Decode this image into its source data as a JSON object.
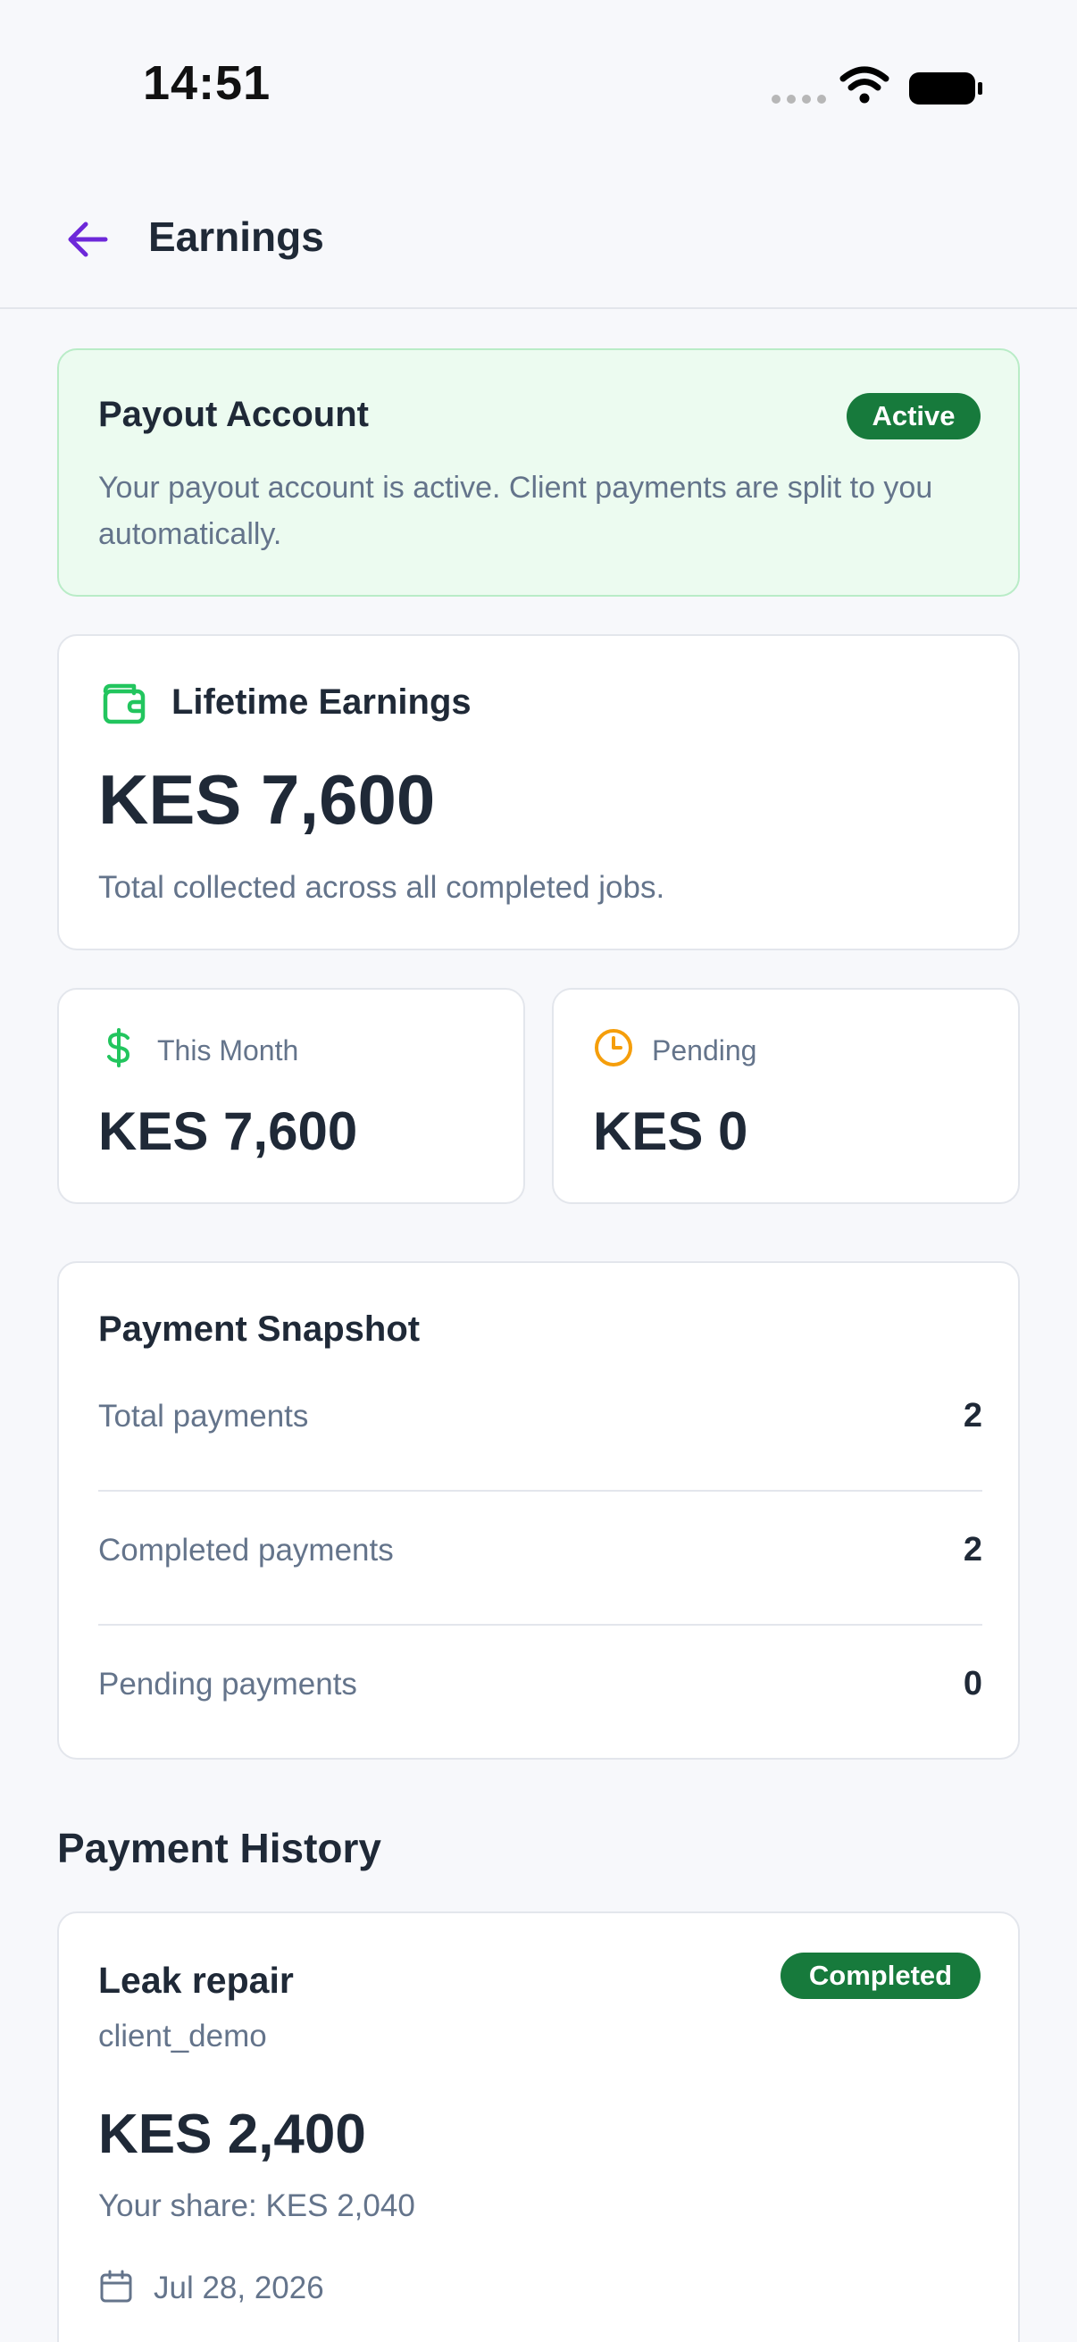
{
  "status_bar": {
    "time": "14:51"
  },
  "header": {
    "title": "Earnings",
    "back_icon": "arrow-left-icon",
    "accent_color": "#6d28d9"
  },
  "payout_account": {
    "title": "Payout Account",
    "status": "Active",
    "description": "Your payout account is active. Client payments are split to you automatically."
  },
  "lifetime": {
    "title": "Lifetime Earnings",
    "amount": "KES 7,600",
    "description": "Total collected across all completed jobs.",
    "icon": "wallet-icon"
  },
  "stats": {
    "this_month": {
      "label": "This Month",
      "value": "KES 7,600",
      "icon": "dollar-icon"
    },
    "pending": {
      "label": "Pending",
      "value": "KES 0",
      "icon": "clock-icon"
    }
  },
  "snapshot": {
    "title": "Payment Snapshot",
    "rows": [
      {
        "label": "Total payments",
        "value": "2"
      },
      {
        "label": "Completed payments",
        "value": "2"
      },
      {
        "label": "Pending payments",
        "value": "0"
      }
    ]
  },
  "history": {
    "heading": "Payment History",
    "items": [
      {
        "title": "Leak repair",
        "status": "Completed",
        "client": "client_demo",
        "amount": "KES 2,400",
        "share": "Your share: KES 2,040",
        "date": "Jul 28, 2026"
      }
    ]
  },
  "colors": {
    "success": "#177a3c",
    "success_bg": "#ecfbf0",
    "green_icon": "#22c55e",
    "amber_icon": "#f59e0b"
  }
}
